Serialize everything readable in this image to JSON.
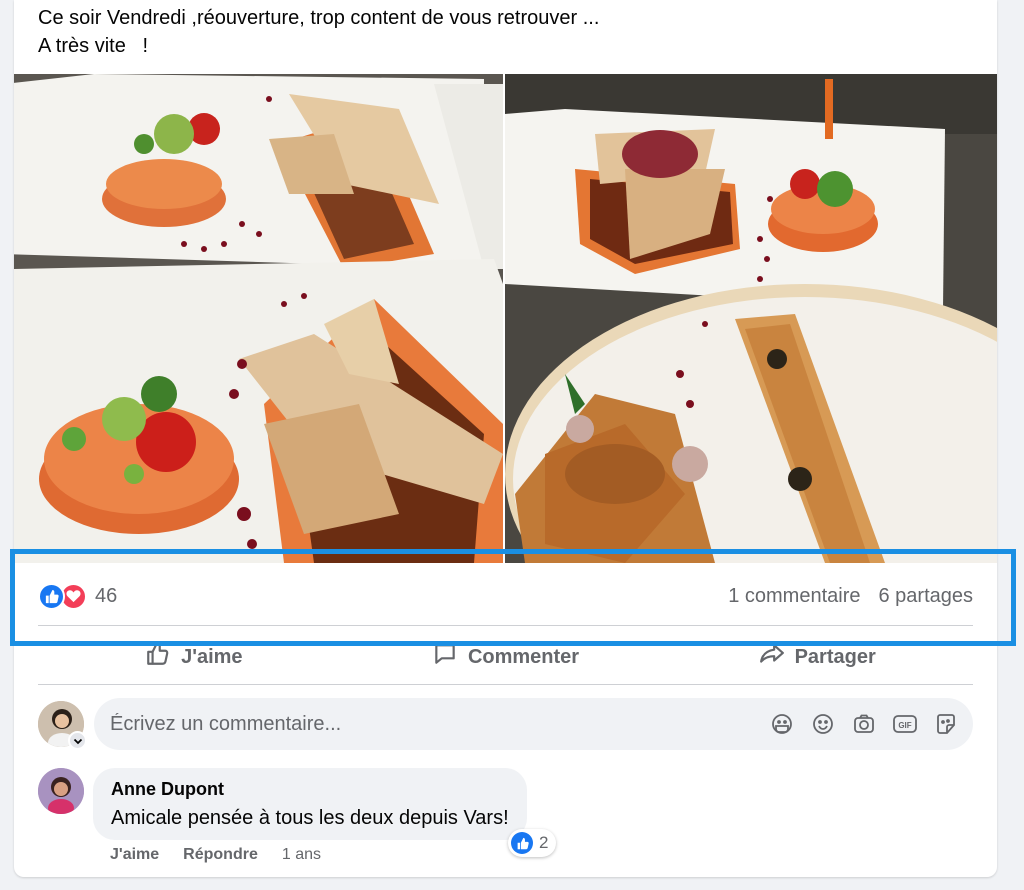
{
  "post": {
    "text_line1": "Ce soir Vendredi ,réouverture, trop content de vous retrouver ...",
    "text_line2": "A très vite   !"
  },
  "stats": {
    "reaction_count": "46",
    "comments": "1 commentaire",
    "shares": "6 partages"
  },
  "actions": {
    "like": "J'aime",
    "comment": "Commenter",
    "share": "Partager"
  },
  "composer": {
    "placeholder": "Écrivez un commentaire...",
    "icons": [
      "sticker-icon",
      "emoji-icon",
      "camera-icon",
      "gif-icon",
      "avatar-sticker-icon"
    ]
  },
  "comment": {
    "author": "Anne Dupont",
    "text": "Amicale pensée à tous les deux depuis Vars!",
    "reaction_count": "2",
    "like_label": "J'aime",
    "reply_label": "Répondre",
    "time": "1 ans"
  },
  "colors": {
    "like_blue": "#1877f2",
    "love_red": "#f33e58",
    "highlight": "#1a8fe3"
  }
}
